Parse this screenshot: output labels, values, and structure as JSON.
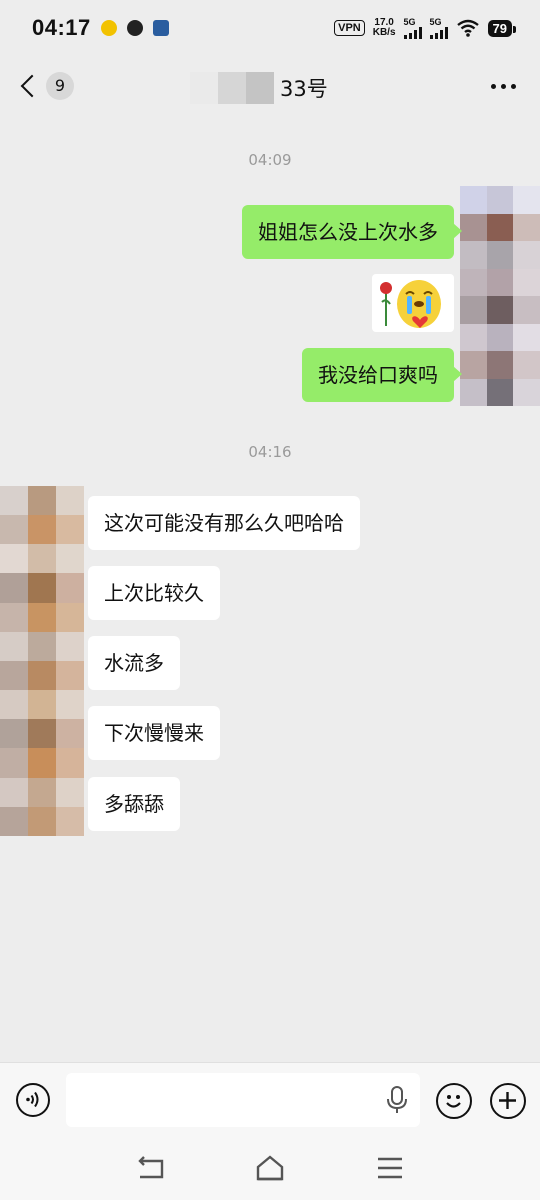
{
  "status_bar": {
    "time": "04:17",
    "vpn": "VPN",
    "net_speed_value": "17.0",
    "net_speed_unit": "KB/s",
    "signal1": "5G",
    "signal2": "5G",
    "battery": "79"
  },
  "header": {
    "unread_count": "9",
    "title": "33号",
    "more_icon": "more-horizontal-icon"
  },
  "chat": {
    "timestamp1": "04:09",
    "timestamp2": "04:16",
    "messages": [
      {
        "sender": "me",
        "text": "姐姐怎么没上次水多"
      },
      {
        "sender": "me",
        "type": "sticker",
        "icon": "crying-sticker-with-rose"
      },
      {
        "sender": "me",
        "text": "我没给口爽吗"
      },
      {
        "sender": "them",
        "text": "这次可能没有那么久吧哈哈"
      },
      {
        "sender": "them",
        "text": "上次比较久"
      },
      {
        "sender": "them",
        "text": "水流多"
      },
      {
        "sender": "them",
        "text": "下次慢慢来"
      },
      {
        "sender": "them",
        "text": "多舔舔"
      }
    ]
  },
  "input_bar": {
    "value": "",
    "voice_icon": "voice-icon",
    "mic_icon": "microphone-icon",
    "emoji_icon": "emoji-icon",
    "plus_icon": "plus-icon"
  },
  "nav_bar": {
    "back_icon": "nav-back-icon",
    "home_icon": "home-icon",
    "menu_icon": "menu-icon"
  },
  "colors": {
    "background": "#ededed",
    "my_bubble": "#95ec69",
    "their_bubble": "#ffffff",
    "timestamp": "#9a9a9a"
  }
}
